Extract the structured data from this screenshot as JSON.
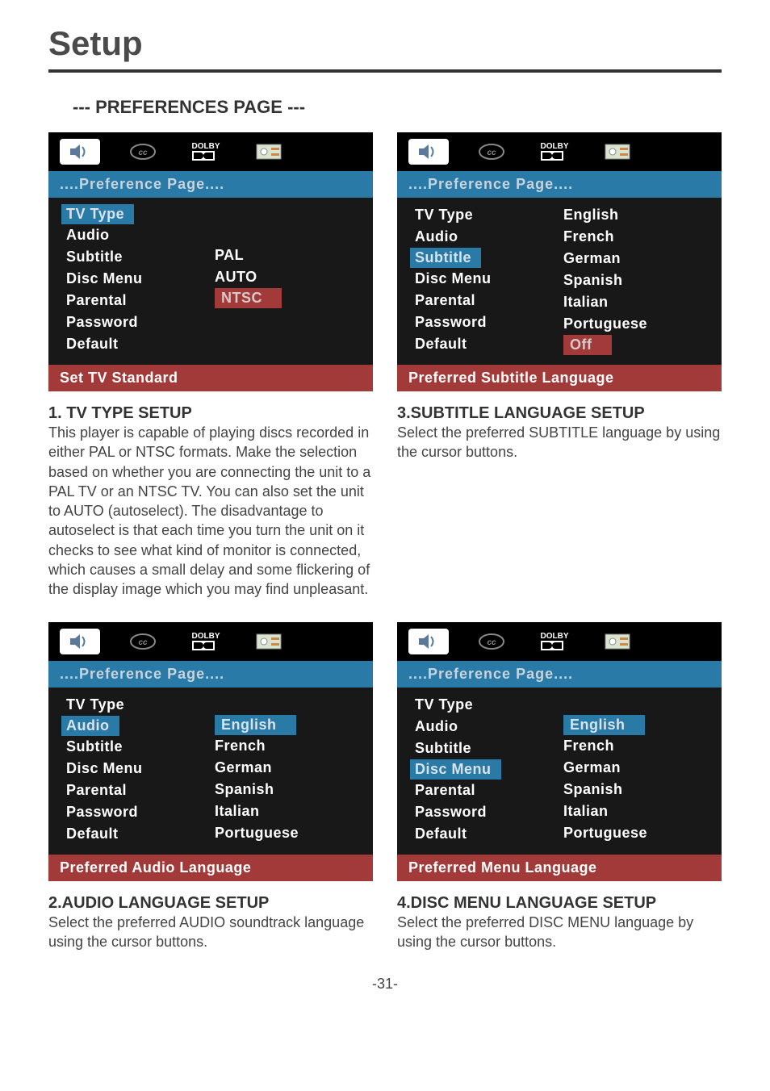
{
  "page": {
    "title": "Setup",
    "subheader": "--- PREFERENCES PAGE ---",
    "pageNumber": "-31-"
  },
  "menuHeader": "....Preference Page....",
  "dolbyLabel": "DOLBY",
  "card1": {
    "items": [
      "TV Type",
      "Audio",
      "Subtitle",
      "Disc Menu",
      "Parental",
      "Password",
      "Default"
    ],
    "right": [
      "PAL",
      "AUTO",
      "NTSC"
    ],
    "highlightLeft": "TV Type",
    "selectedRight": "NTSC",
    "footer": "Set TV Standard"
  },
  "card2": {
    "items": [
      "TV Type",
      "Audio",
      "Subtitle",
      "Disc Menu",
      "Parental",
      "Password",
      "Default"
    ],
    "right": [
      "English",
      "French",
      "German",
      "Spanish",
      "Italian",
      "Portuguese",
      "Off"
    ],
    "highlightLeft": "Subtitle",
    "selectedRight": "Off",
    "footer": "Preferred Subtitle Language"
  },
  "card3": {
    "items": [
      "TV Type",
      "Audio",
      "Subtitle",
      "Disc Menu",
      "Parental",
      "Password",
      "Default"
    ],
    "right": [
      "English",
      "French",
      "German",
      "Spanish",
      "Italian",
      "Portuguese"
    ],
    "highlightLeft": "Audio",
    "selectedRight": "English",
    "footer": "Preferred Audio Language"
  },
  "card4": {
    "items": [
      "TV Type",
      "Audio",
      "Subtitle",
      "Disc Menu",
      "Parental",
      "Password",
      "Default"
    ],
    "right": [
      "English",
      "French",
      "German",
      "Spanish",
      "Italian",
      "Portuguese"
    ],
    "highlightLeft": "Disc Menu",
    "selectedRight": "English",
    "footer": "Preferred Menu Language"
  },
  "sections": {
    "s1": {
      "h": "1. TV TYPE SETUP",
      "p": "This player is capable of playing discs recorded in either PAL or NTSC formats. Make the selection based on whether you are connecting the unit to a PAL TV or an NTSC TV. You can also set the unit to AUTO (autoselect). The disadvantage to autoselect is that each time you turn the unit on it checks to see what kind of monitor is connected, which causes a small delay and some flickering of the display image which you may find unpleasant."
    },
    "s2": {
      "h": "2.AUDIO LANGUAGE SETUP",
      "p": "Select the preferred AUDIO soundtrack language using the cursor buttons."
    },
    "s3": {
      "h": "3.SUBTITLE LANGUAGE SETUP",
      "p": "Select the preferred SUBTITLE language by using the cursor buttons."
    },
    "s4": {
      "h": "4.DISC MENU LANGUAGE SETUP",
      "p": "Select the preferred DISC MENU language by using the cursor buttons."
    }
  }
}
